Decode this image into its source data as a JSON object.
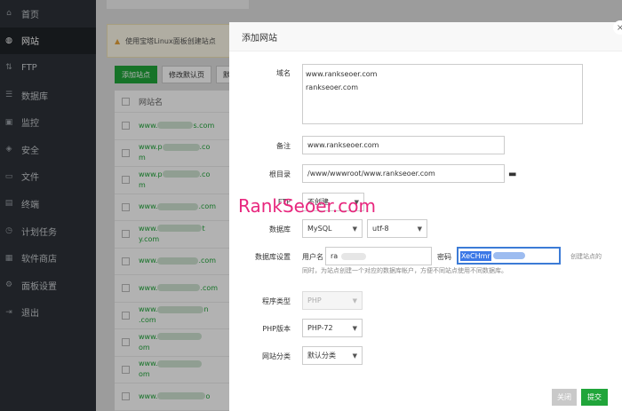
{
  "sidebar": {
    "items": [
      {
        "label": "首页",
        "icon": "home-icon",
        "glyph": "⌂"
      },
      {
        "label": "网站",
        "icon": "globe-icon",
        "glyph": "◍"
      },
      {
        "label": "FTP",
        "icon": "ftp-icon",
        "glyph": "⇅"
      },
      {
        "label": "数据库",
        "icon": "database-icon",
        "glyph": "☰"
      },
      {
        "label": "监控",
        "icon": "monitor-icon",
        "glyph": "▣"
      },
      {
        "label": "安全",
        "icon": "shield-icon",
        "glyph": "◈"
      },
      {
        "label": "文件",
        "icon": "folder-icon",
        "glyph": "▭"
      },
      {
        "label": "终端",
        "icon": "terminal-icon",
        "glyph": "▤"
      },
      {
        "label": "计划任务",
        "icon": "clock-icon",
        "glyph": "◷"
      },
      {
        "label": "软件商店",
        "icon": "store-icon",
        "glyph": "▦"
      },
      {
        "label": "面板设置",
        "icon": "gear-icon",
        "glyph": "⚙"
      },
      {
        "label": "退出",
        "icon": "logout-icon",
        "glyph": "⇥"
      }
    ],
    "active_index": 1
  },
  "background": {
    "notice": "使用宝塔Linux面板创建站点",
    "buttons": {
      "add_site": "添加站点",
      "modify_default": "修改默认页",
      "default_site": "默"
    },
    "table_header": "网站名",
    "rows": [
      {
        "pre": "www.",
        "post": "s.com"
      },
      {
        "pre": "www.p",
        "post": ".co",
        "line2": "m"
      },
      {
        "pre": "www.p",
        "post": ".co",
        "line2": "m"
      },
      {
        "pre": "www.",
        "post": ".com"
      },
      {
        "pre": "www.",
        "post": "t",
        "line2": "y.com"
      },
      {
        "pre": "www.",
        "post": ".com"
      },
      {
        "pre": "www.",
        "post": ".com"
      },
      {
        "pre": "www.",
        "post": "n",
        "line2": ".com"
      },
      {
        "pre": "www.",
        "post": "",
        "line2": "om"
      },
      {
        "pre": "www.",
        "post": "",
        "line2": "om"
      },
      {
        "pre": "www.",
        "post": "o"
      }
    ]
  },
  "modal": {
    "title": "添加网站",
    "close_glyph": "×",
    "domain_label": "域名",
    "domain_lines": [
      "www.rankseoer.com",
      "rankseoer.com"
    ],
    "remark_label": "备注",
    "remark_value": "www.rankseoer.com",
    "root_label": "根目录",
    "root_value": "/www/wwwroot/www.rankseoer.com",
    "ftp_label": "FTP",
    "ftp_value": "不创建",
    "db_label": "数据库",
    "db_type": "MySQL",
    "db_charset": "utf-8",
    "db_settings_label": "数据库设置",
    "username_label": "用户名",
    "username_value": "ra",
    "password_label": "密码",
    "password_value": "XeCHmr",
    "db_hint_right": "创建站点的",
    "db_hint": "同时，为站点创建一个对应的数据库帐户，方便不同站点使用不同数据库。",
    "program_type_label": "程序类型",
    "program_type_value": "PHP",
    "php_version_label": "PHP版本",
    "php_version_value": "PHP-72",
    "category_label": "网站分类",
    "category_value": "默认分类",
    "cancel_label": "关闭",
    "submit_label": "提交"
  },
  "watermark": "RankSeoer.com",
  "colors": {
    "accent": "#20a53a",
    "sidebar": "#2d3238",
    "selection": "#3b78e7",
    "watermark": "#e8277e"
  }
}
